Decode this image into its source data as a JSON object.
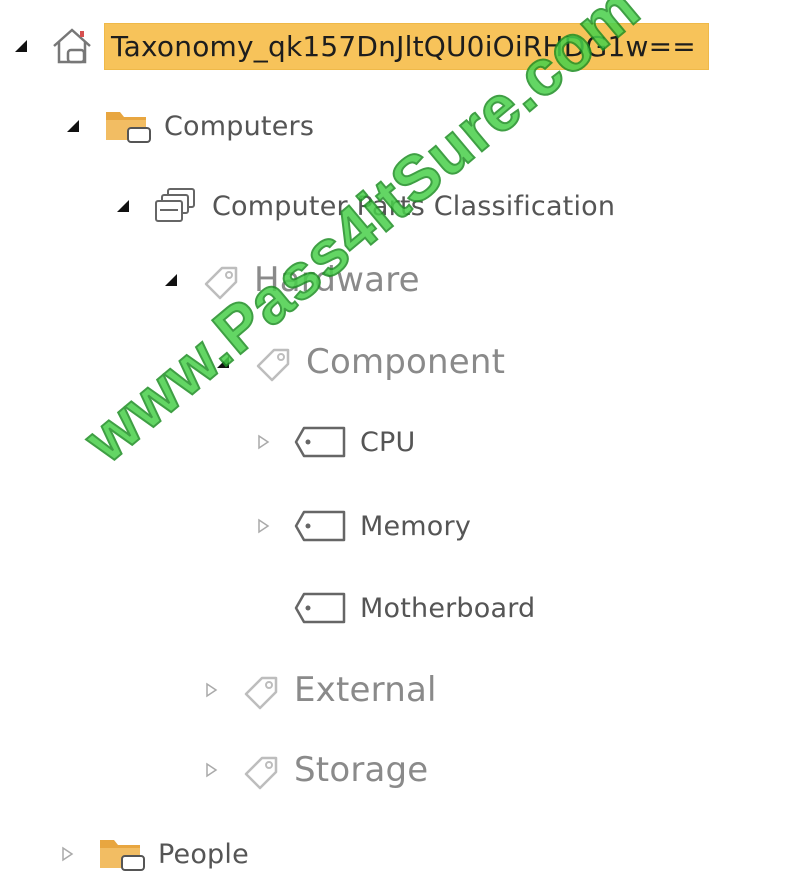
{
  "tree": {
    "root": {
      "label": "Taxonomy_qk157DnJltQU0iOiRHDG1w==",
      "icon": "site-home-icon",
      "expanded": true
    },
    "group_computers": {
      "label": "Computers",
      "icon": "folder-group-icon",
      "expanded": true
    },
    "termset": {
      "label": "Computer Parts Classification",
      "icon": "term-set-icon",
      "expanded": true
    },
    "hardware": {
      "label": "Hardware",
      "icon": "tag-icon",
      "expanded": true
    },
    "component": {
      "label": "Component",
      "icon": "tag-icon",
      "expanded": true
    },
    "cpu": {
      "label": "CPU",
      "icon": "term-label-icon",
      "expanded": false
    },
    "memory": {
      "label": "Memory",
      "icon": "term-label-icon",
      "expanded": false
    },
    "motherboard": {
      "label": "Motherboard",
      "icon": "term-label-icon"
    },
    "external": {
      "label": "External",
      "icon": "tag-icon",
      "expanded": false
    },
    "storage": {
      "label": "Storage",
      "icon": "tag-icon",
      "expanded": false
    },
    "group_people": {
      "label": "People",
      "icon": "folder-group-icon",
      "expanded": false
    }
  },
  "watermark": "www.Pass4itSure.com",
  "colors": {
    "selection": "#f7c35a",
    "folder": "#e8a640",
    "watermark": "#48d04a"
  }
}
